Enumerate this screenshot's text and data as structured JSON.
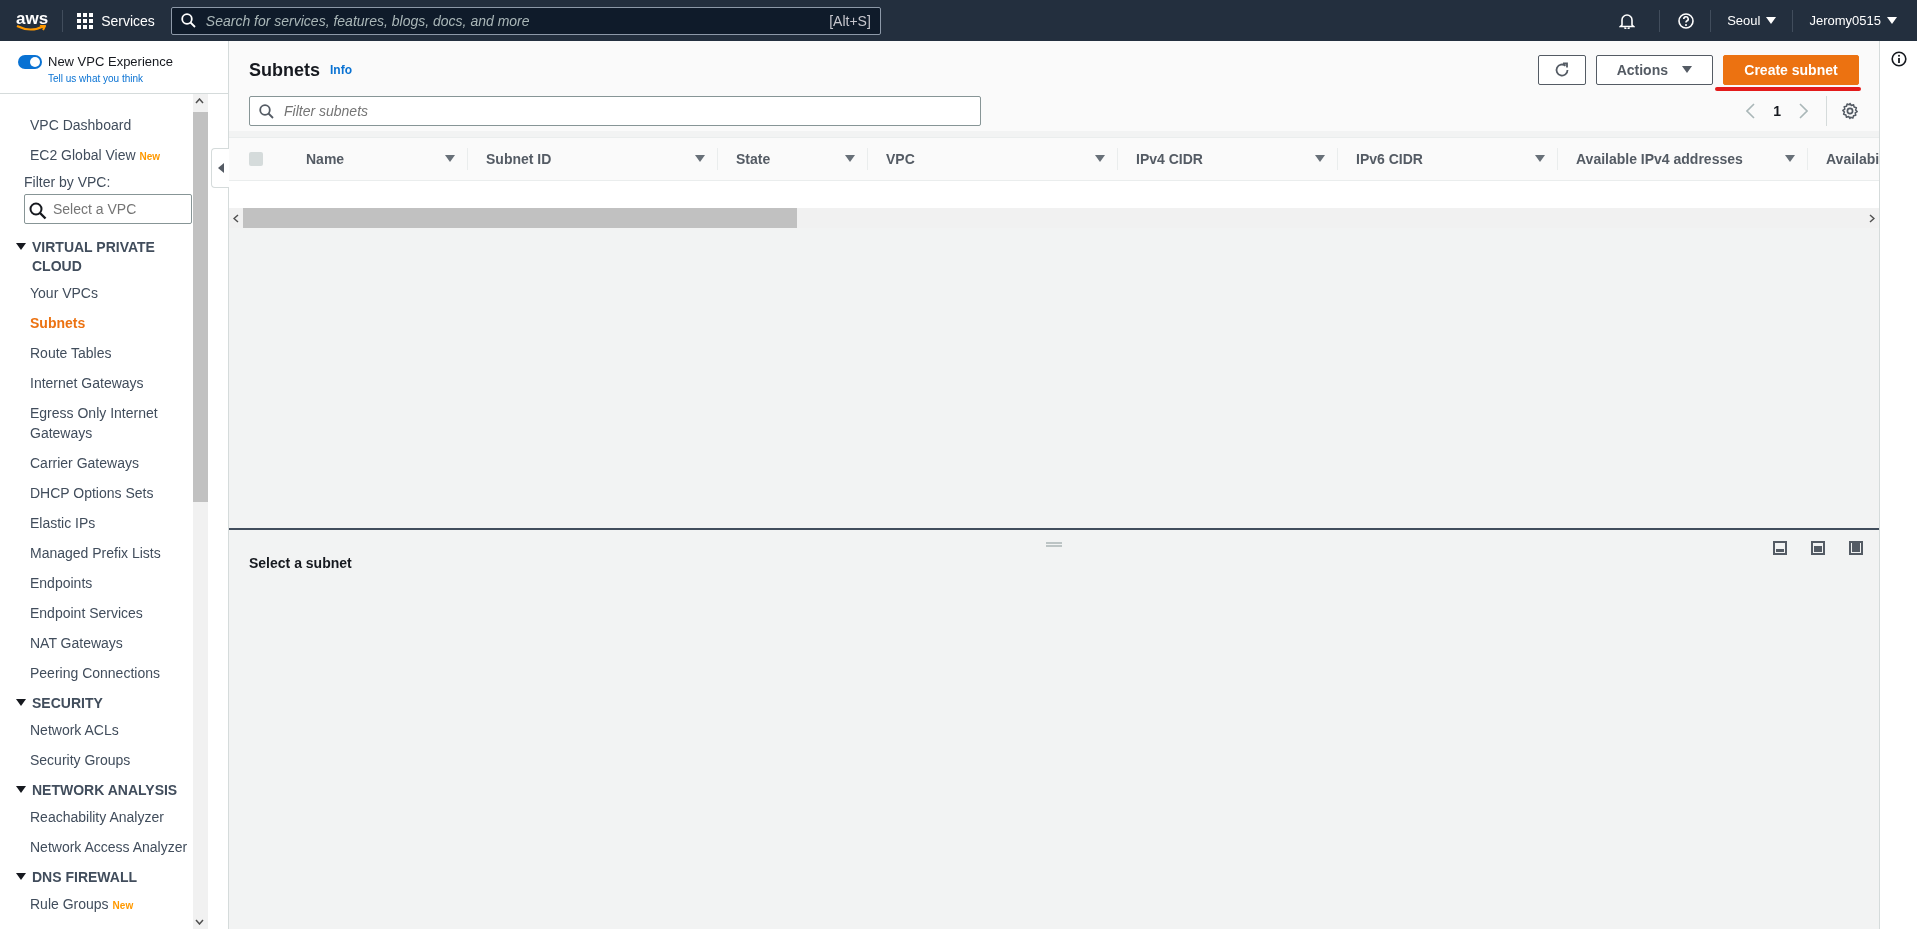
{
  "top_nav": {
    "logo": "aws",
    "services": "Services",
    "search_placeholder": "Search for services, features, blogs, docs, and more",
    "shortcut": "[Alt+S]",
    "region": "Seoul",
    "user": "Jeromy0515"
  },
  "sidebar": {
    "toggle": {
      "label": "New VPC Experience",
      "on": true
    },
    "feedback_link": "Tell us what you think",
    "items": [
      {
        "label": "VPC Dashboard"
      },
      {
        "label": "EC2 Global View",
        "badge": "New"
      }
    ],
    "filter_label": "Filter by VPC:",
    "filter_placeholder": "Select a VPC",
    "sections": [
      {
        "title": "VIRTUAL PRIVATE CLOUD",
        "expanded": true,
        "items": [
          {
            "label": "Your VPCs",
            "selected": false
          },
          {
            "label": "Subnets",
            "selected": true
          },
          {
            "label": "Route Tables",
            "selected": false
          },
          {
            "label": "Internet Gateways",
            "selected": false
          },
          {
            "label": "Egress Only Internet Gateways",
            "selected": false
          },
          {
            "label": "Carrier Gateways",
            "selected": false
          },
          {
            "label": "DHCP Options Sets",
            "selected": false
          },
          {
            "label": "Elastic IPs",
            "selected": false
          },
          {
            "label": "Managed Prefix Lists",
            "selected": false
          },
          {
            "label": "Endpoints",
            "selected": false
          },
          {
            "label": "Endpoint Services",
            "selected": false
          },
          {
            "label": "NAT Gateways",
            "selected": false
          },
          {
            "label": "Peering Connections",
            "selected": false
          }
        ]
      },
      {
        "title": "SECURITY",
        "expanded": true,
        "items": [
          {
            "label": "Network ACLs",
            "selected": false
          },
          {
            "label": "Security Groups",
            "selected": false
          }
        ]
      },
      {
        "title": "NETWORK ANALYSIS",
        "expanded": true,
        "items": [
          {
            "label": "Reachability Analyzer",
            "selected": false
          },
          {
            "label": "Network Access Analyzer",
            "selected": false
          }
        ]
      },
      {
        "title": "DNS FIREWALL",
        "expanded": true,
        "items": [
          {
            "label": "Rule Groups",
            "selected": false,
            "badge": "New"
          }
        ]
      }
    ]
  },
  "main": {
    "title": "Subnets",
    "info": "Info",
    "actions": "Actions",
    "create": "Create subnet",
    "filter_placeholder": "Filter subnets",
    "page": "1",
    "select_all_checked": false,
    "columns": [
      "Name",
      "Subnet ID",
      "State",
      "VPC",
      "IPv4 CIDR",
      "IPv6 CIDR",
      "Available IPv4 addresses",
      "Availabi"
    ],
    "detail_title": "Select a subnet"
  }
}
